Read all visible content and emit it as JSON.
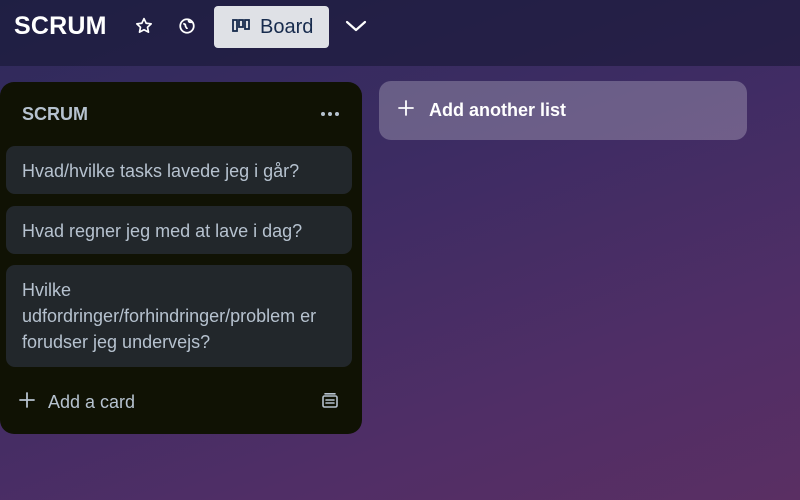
{
  "header": {
    "board_title": "SCRUM",
    "view_button_label": "Board",
    "icons": [
      "star-icon",
      "globe-icon",
      "board-view-icon",
      "chevron-down-icon"
    ]
  },
  "list": {
    "title": "SCRUM",
    "cards": [
      {
        "text": "Hvad/hvilke tasks lavede jeg i går?"
      },
      {
        "text": "Hvad regner jeg med at lave i dag?"
      },
      {
        "text": "Hvilke udfordringer/forhindringer/problem er forudser jeg undervejs?"
      }
    ],
    "add_card_label": "Add a card"
  },
  "add_list_label": "Add another list",
  "colors": {
    "list_bg": "#101204",
    "card_bg": "#22272b",
    "text": "#b6c2cf",
    "board_button_bg": "#dfe1e6"
  }
}
